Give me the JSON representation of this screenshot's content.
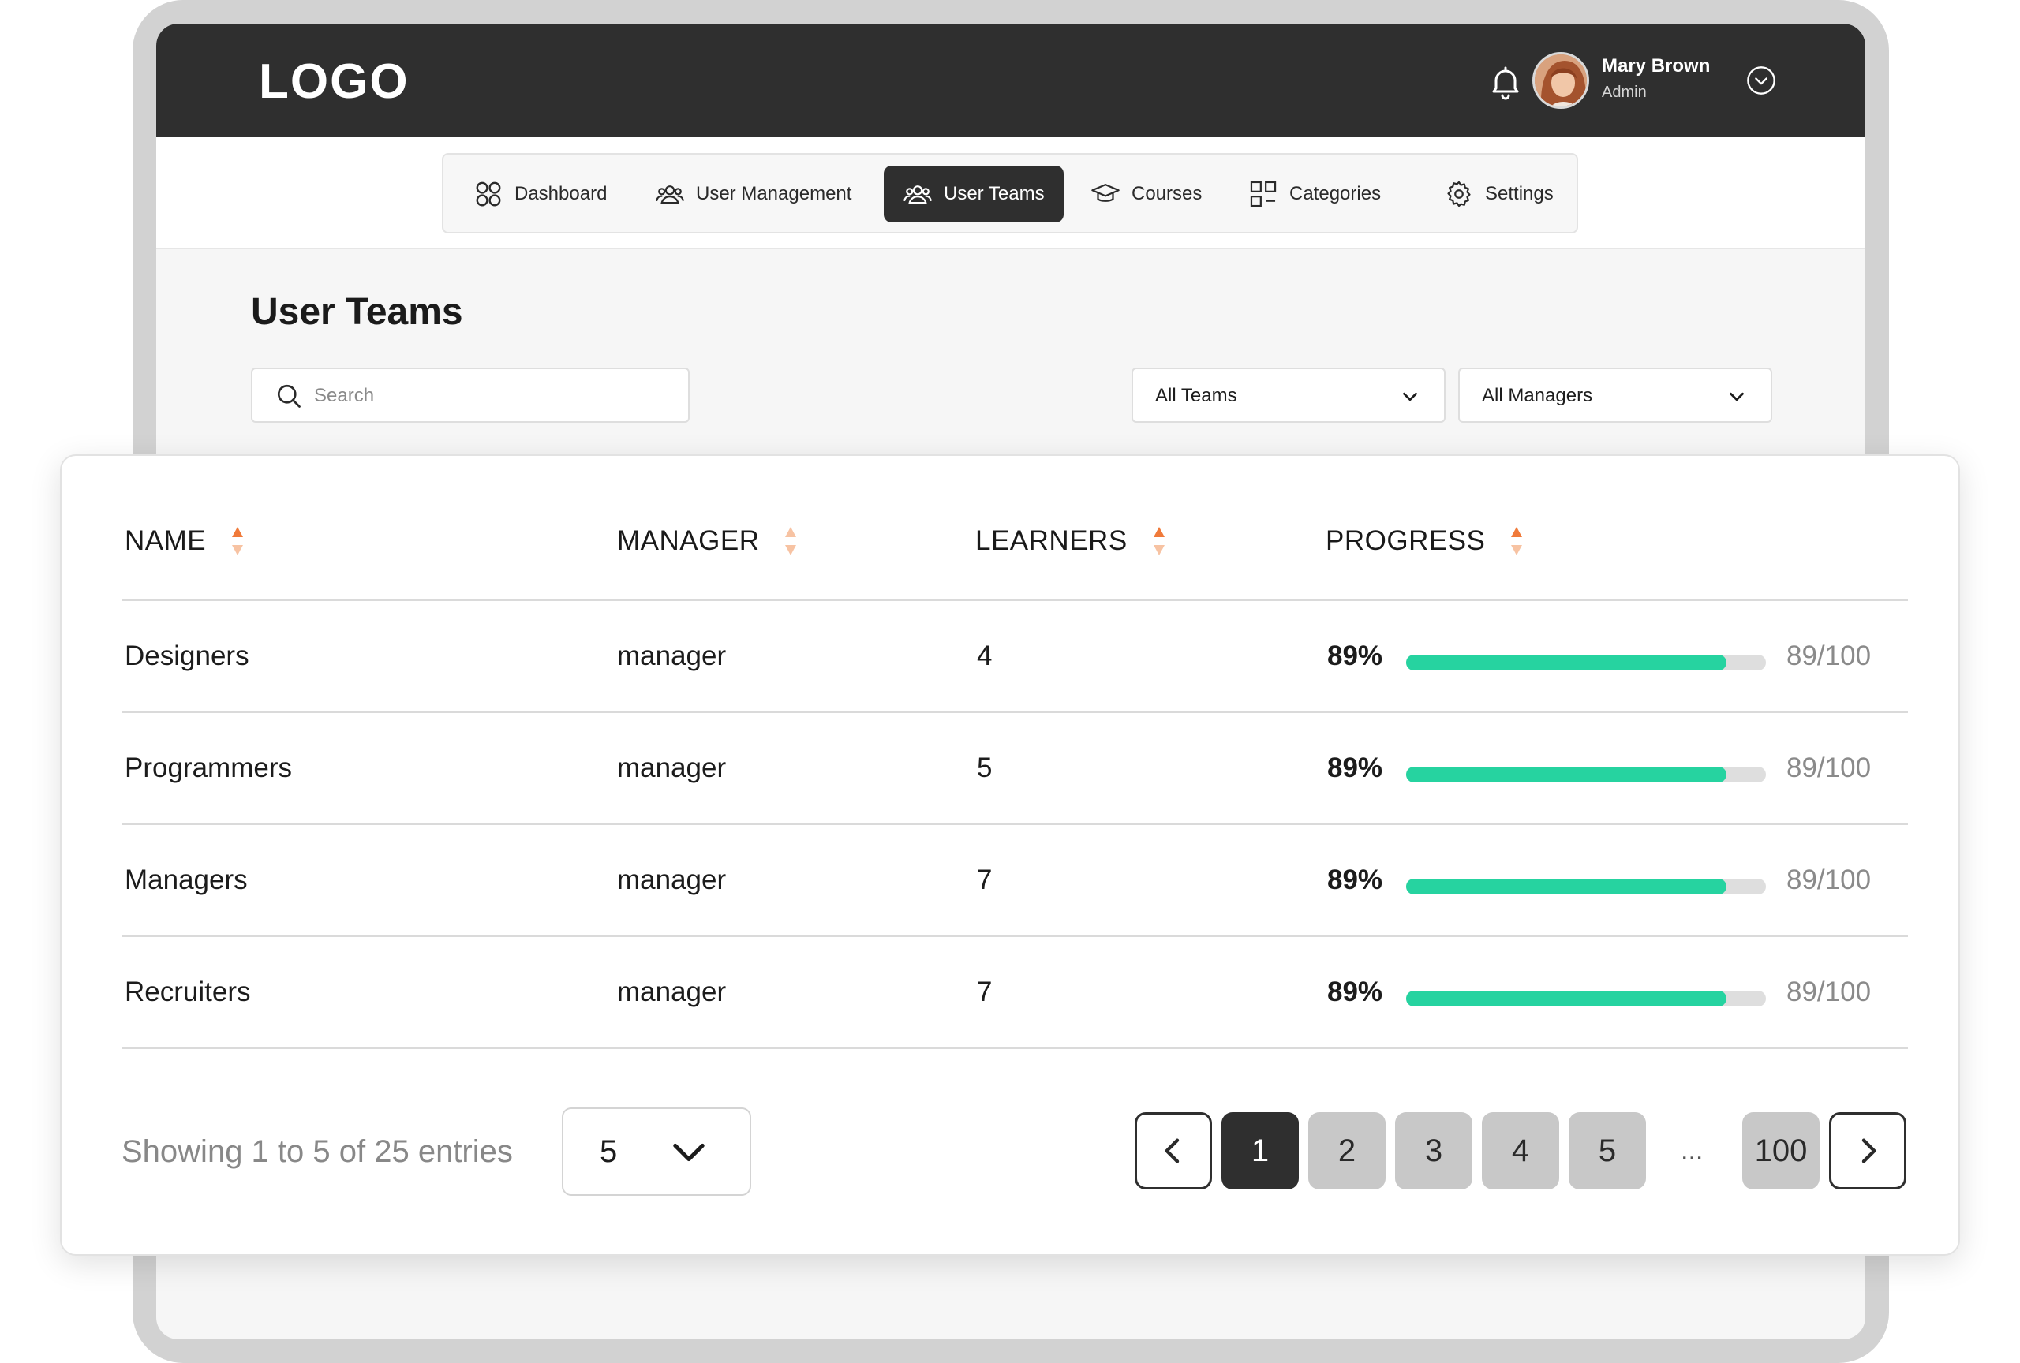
{
  "app": {
    "logo": "LOGO",
    "user": {
      "name": "Mary Brown",
      "role": "Admin"
    }
  },
  "nav": {
    "items": [
      {
        "label": "Dashboard",
        "icon": "dashboard-icon"
      },
      {
        "label": "User Management",
        "icon": "users-icon"
      },
      {
        "label": "User Teams",
        "icon": "users-icon",
        "active": true
      },
      {
        "label": "Courses",
        "icon": "graduation-cap-icon"
      },
      {
        "label": "Categories",
        "icon": "grid-icon"
      },
      {
        "label": "Settings",
        "icon": "gear-icon"
      }
    ]
  },
  "page": {
    "title": "User Teams",
    "search_placeholder": "Search",
    "filters": {
      "teams": "All Teams",
      "managers": "All Managers"
    }
  },
  "table": {
    "columns": [
      "NAME",
      "MANAGER",
      "LEARNERS",
      "PROGRESS"
    ],
    "rows": [
      {
        "name": "Designers",
        "manager": "manager",
        "learners": "4",
        "progress_pct": "89%",
        "progress_ratio": "89/100",
        "progress_value": 0.89
      },
      {
        "name": "Programmers",
        "manager": "manager",
        "learners": "5",
        "progress_pct": "89%",
        "progress_ratio": "89/100",
        "progress_value": 0.89
      },
      {
        "name": "Managers",
        "manager": "manager",
        "learners": "7",
        "progress_pct": "89%",
        "progress_ratio": "89/100",
        "progress_value": 0.89
      },
      {
        "name": "Recruiters",
        "manager": "manager",
        "learners": "7",
        "progress_pct": "89%",
        "progress_ratio": "89/100",
        "progress_value": 0.89
      }
    ]
  },
  "footer": {
    "showing": "Showing 1 to 5 of 25 entries",
    "per_page": "5",
    "pages": [
      "1",
      "2",
      "3",
      "4",
      "5"
    ],
    "ellipsis": "...",
    "last_page": "100",
    "current_page": "1"
  },
  "colors": {
    "dark": "#2f2f2f",
    "progress": "#26d3a0",
    "sort_accent": "#f07a3a"
  }
}
